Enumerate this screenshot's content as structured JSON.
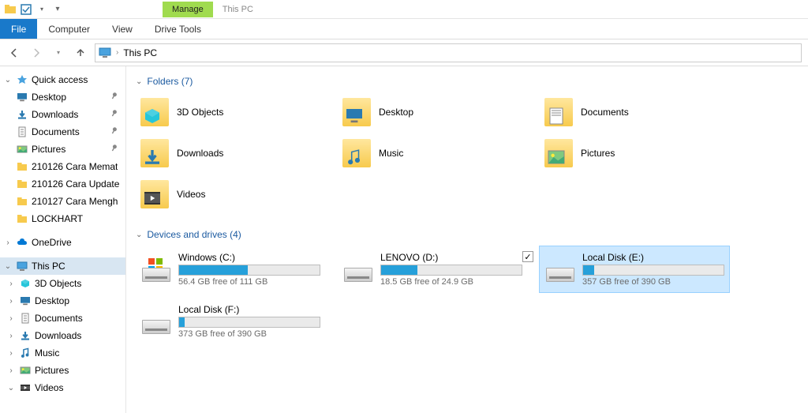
{
  "titlebar": {
    "context_tab": "Manage",
    "window_tab": "This PC"
  },
  "ribbon": {
    "file": "File",
    "computer": "Computer",
    "view": "View",
    "drive_tools": "Drive Tools"
  },
  "breadcrumb": {
    "location": "This PC"
  },
  "sidebar": {
    "quick_access": "Quick access",
    "quick_items": [
      {
        "label": "Desktop",
        "pinned": true,
        "icon": "desktop"
      },
      {
        "label": "Downloads",
        "pinned": true,
        "icon": "downloads"
      },
      {
        "label": "Documents",
        "pinned": true,
        "icon": "documents"
      },
      {
        "label": "Pictures",
        "pinned": true,
        "icon": "pictures"
      },
      {
        "label": "210126 Cara Memat",
        "pinned": false,
        "icon": "folder"
      },
      {
        "label": "210126 Cara Update",
        "pinned": false,
        "icon": "folder"
      },
      {
        "label": "210127 Cara Mengh",
        "pinned": false,
        "icon": "folder"
      },
      {
        "label": "LOCKHART",
        "pinned": false,
        "icon": "folder"
      }
    ],
    "onedrive": "OneDrive",
    "this_pc": "This PC",
    "pc_items": [
      {
        "label": "3D Objects",
        "icon": "3d"
      },
      {
        "label": "Desktop",
        "icon": "desktop"
      },
      {
        "label": "Documents",
        "icon": "documents"
      },
      {
        "label": "Downloads",
        "icon": "downloads"
      },
      {
        "label": "Music",
        "icon": "music"
      },
      {
        "label": "Pictures",
        "icon": "pictures"
      },
      {
        "label": "Videos",
        "icon": "videos"
      }
    ]
  },
  "content": {
    "folders_header": "Folders (7)",
    "drives_header": "Devices and drives (4)",
    "folders": [
      {
        "label": "3D Objects",
        "icon": "3d"
      },
      {
        "label": "Desktop",
        "icon": "desktop"
      },
      {
        "label": "Documents",
        "icon": "documents"
      },
      {
        "label": "Downloads",
        "icon": "downloads"
      },
      {
        "label": "Music",
        "icon": "music"
      },
      {
        "label": "Pictures",
        "icon": "pictures"
      },
      {
        "label": "Videos",
        "icon": "videos"
      }
    ],
    "drives": [
      {
        "label": "Windows (C:)",
        "free": "56.4 GB free of 111 GB",
        "fill_pct": 49,
        "os": true,
        "selected": false
      },
      {
        "label": "LENOVO (D:)",
        "free": "18.5 GB free of 24.9 GB",
        "fill_pct": 26,
        "os": false,
        "selected": false
      },
      {
        "label": "Local Disk (E:)",
        "free": "357 GB free of 390 GB",
        "fill_pct": 8,
        "os": false,
        "selected": true
      },
      {
        "label": "Local Disk (F:)",
        "free": "373 GB free of 390 GB",
        "fill_pct": 4,
        "os": false,
        "selected": false
      }
    ]
  }
}
